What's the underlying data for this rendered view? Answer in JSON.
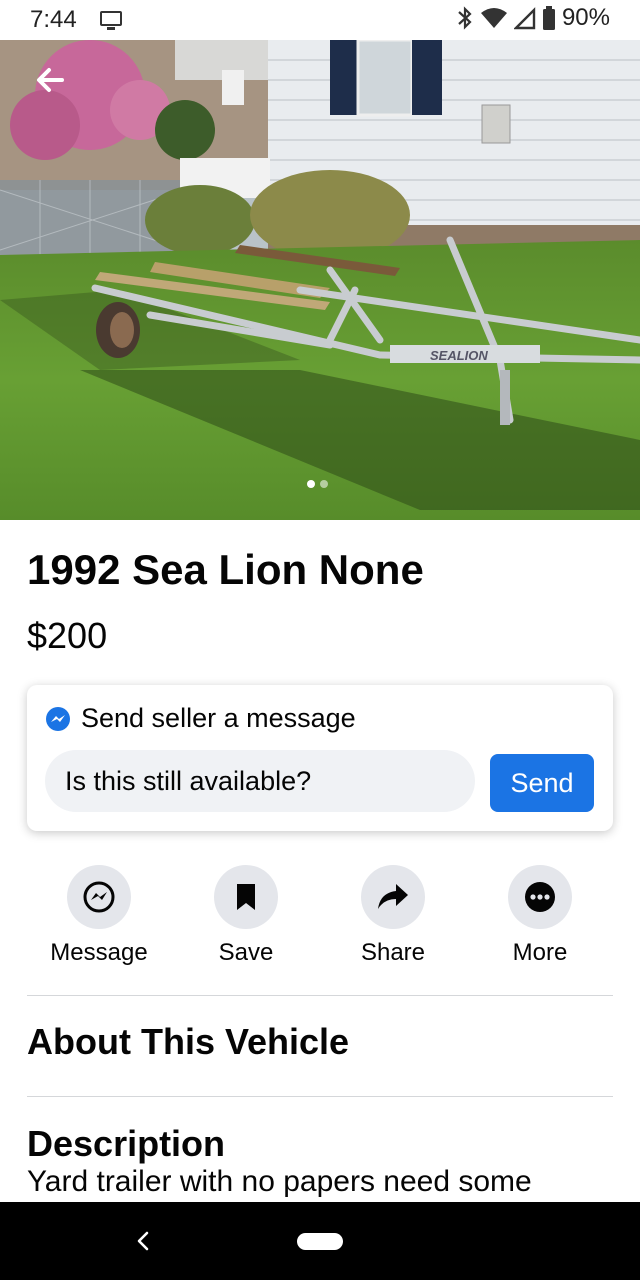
{
  "status_bar": {
    "time": "7:44",
    "battery": "90%",
    "icons": [
      "cast-icon",
      "bluetooth-icon",
      "wifi-icon",
      "signal-icon",
      "battery-icon"
    ]
  },
  "hero": {
    "photo_sign_text": "SEALION",
    "image_count": 2,
    "active_image": 1
  },
  "listing": {
    "title": "1992 Sea Lion None",
    "price": "$200"
  },
  "message_card": {
    "heading": "Send seller a message",
    "input_value": "Is this still available?",
    "send_label": "Send"
  },
  "actions": [
    {
      "label": "Message",
      "icon": "messenger-icon"
    },
    {
      "label": "Save",
      "icon": "bookmark-icon"
    },
    {
      "label": "Share",
      "icon": "share-arrow-icon"
    },
    {
      "label": "More",
      "icon": "more-dots-icon"
    }
  ],
  "about": {
    "heading": "About This Vehicle"
  },
  "description": {
    "heading": "Description",
    "text": "Yard trailer with no papers need some"
  },
  "colors": {
    "accent": "#1b74e4",
    "icon_bg": "#e4e6eb",
    "input_bg": "#f0f2f5"
  }
}
